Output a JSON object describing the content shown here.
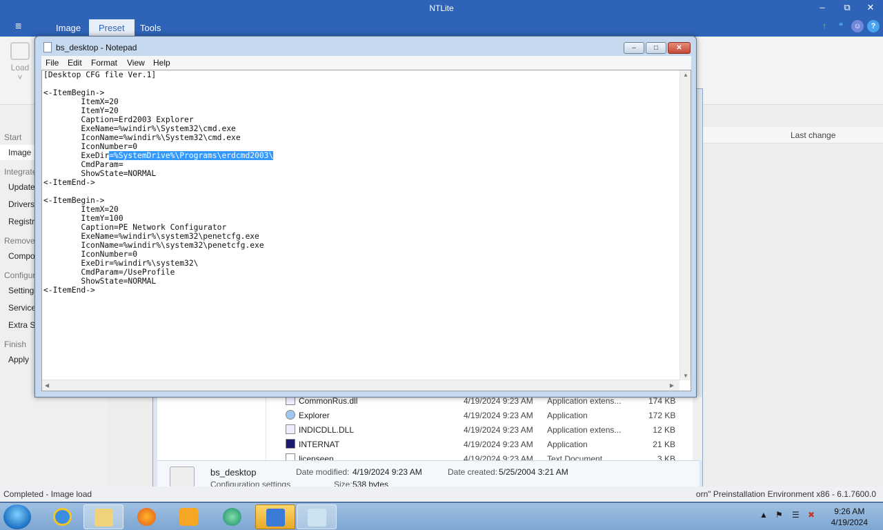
{
  "ntlite": {
    "title": "NTLite",
    "window_buttons": {
      "minimize": "–",
      "restore": "⧉",
      "close": "✕"
    },
    "menu_icon": "≡",
    "tabs": [
      "Image",
      "Preset",
      "Tools"
    ],
    "ribbon": {
      "load_label": "Load",
      "load_arrow": "˅"
    },
    "sidebar": {
      "start": "Start",
      "image": "Image",
      "integrate": "Integrate",
      "updates": "Updates",
      "drivers": "Drivers",
      "registry": "Registry",
      "remove": "Remove",
      "components": "Components",
      "configure": "Configure",
      "settings": "Settings",
      "services": "Services",
      "extra_services": "Extra Services",
      "finish": "Finish",
      "apply": "Apply"
    },
    "column_last_change": "Last change",
    "status_left": "Completed - Image load",
    "status_right": "orn\" Preinstallation Environment x86 - 6.1.7600.0"
  },
  "explorer": {
    "files": [
      {
        "name": "CommonRus.dll",
        "date": "4/19/2024 9:23 AM",
        "type": "Application extens...",
        "size": "174 KB"
      },
      {
        "name": "Explorer",
        "date": "4/19/2024 9:23 AM",
        "type": "Application",
        "size": "172 KB"
      },
      {
        "name": "INDICDLL.DLL",
        "date": "4/19/2024 9:23 AM",
        "type": "Application extens...",
        "size": "12 KB"
      },
      {
        "name": "INTERNAT",
        "date": "4/19/2024 9:23 AM",
        "type": "Application",
        "size": "21 KB"
      },
      {
        "name": "licenseen",
        "date": "4/19/2024 9:23 AM",
        "type": "Text Document",
        "size": "3 KB"
      }
    ],
    "details": {
      "name": "bs_desktop",
      "type": "Configuration settings",
      "date_modified_label": "Date modified:",
      "date_modified": "4/19/2024 9:23 AM",
      "date_created_label": "Date created:",
      "date_created": "5/25/2004 3:21 AM",
      "size_label": "Size:",
      "size": "538 bytes"
    }
  },
  "notepad": {
    "title": "bs_desktop - Notepad",
    "menu": [
      "File",
      "Edit",
      "Format",
      "View",
      "Help"
    ],
    "text_before_selection": "[Desktop CFG file Ver.1]\n\n<-ItemBegin->\n        ItemX=20\n        ItemY=20\n        Caption=Erd2003 Explorer\n        ExeName=%windir%\\System32\\cmd.exe\n        IconName=%windir%\\System32\\cmd.exe\n        IconNumber=0\n        ExeDir",
    "selected_text": "=%SystemDrive%\\Programs\\erdcmd2003\\",
    "text_after_selection": "\n        CmdParam=\n        ShowState=NORMAL\n<-ItemEnd->\n\n<-ItemBegin->\n        ItemX=20\n        ItemY=100\n        Caption=PE Network Configurator\n        ExeName=%windir%\\system32\\penetcfg.exe\n        IconName=%windir%\\system32\\penetcfg.exe\n        IconNumber=0\n        ExeDir=%windir%\\system32\\\n        CmdParam=/UseProfile\n        ShowState=NORMAL\n<-ItemEnd->"
  },
  "taskbar": {
    "time": "9:26 AM",
    "date": "4/19/2024"
  },
  "colors": {
    "ntlite_blue": "#2e63b8",
    "selection": "#3399ff",
    "taskbar": "#8db3dc"
  }
}
